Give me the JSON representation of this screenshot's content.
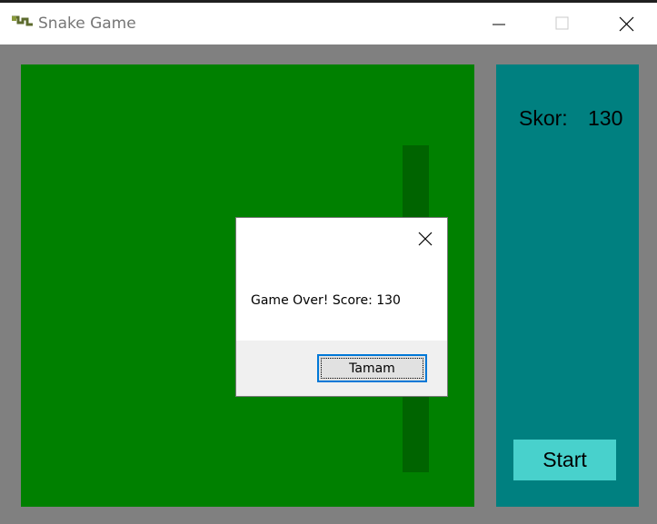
{
  "window": {
    "title": "Snake Game",
    "icon": "snake-app-icon",
    "controls": [
      "minimize-icon",
      "maximize-icon",
      "close-icon"
    ]
  },
  "colors": {
    "board": "#008000",
    "snake": "#006400",
    "panel": "#008080",
    "start_button": "#48d1cc",
    "client_background": "#808080"
  },
  "sidebar": {
    "score_label": "Skor:",
    "score_value": "130",
    "start_label": "Start"
  },
  "dialog": {
    "message": "Game Over! Score: 130",
    "ok_label": "Tamam"
  }
}
